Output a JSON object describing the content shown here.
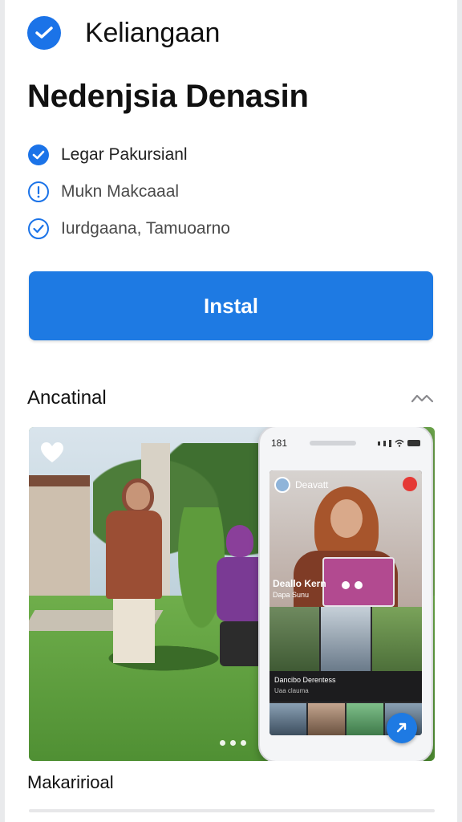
{
  "header": {
    "app_name": "Keliangaan",
    "title": "Nedenjsia Denasin"
  },
  "features": [
    {
      "label": "Legar Pakursianl",
      "icon": "check-circle-filled-icon"
    },
    {
      "label": "Mukn Makcaaal",
      "icon": "info-circle-icon"
    },
    {
      "label": "Iurdgaana, Tamuoarno",
      "icon": "check-circle-outline-icon"
    }
  ],
  "install_label": "Instal",
  "section": {
    "title": "Ancatinal"
  },
  "screenshot": {
    "phone_time": "181",
    "video_top_label": "Deavatt",
    "video_caption": "Deallo Kern",
    "video_caption_sub": "Dapa Sunu",
    "info_title": "Dancibo Derentess",
    "info_sub": "Uaa clauma"
  },
  "footer_label": "Makaririoal",
  "colors": {
    "accent": "#1e7ae3",
    "text": "#111111"
  }
}
